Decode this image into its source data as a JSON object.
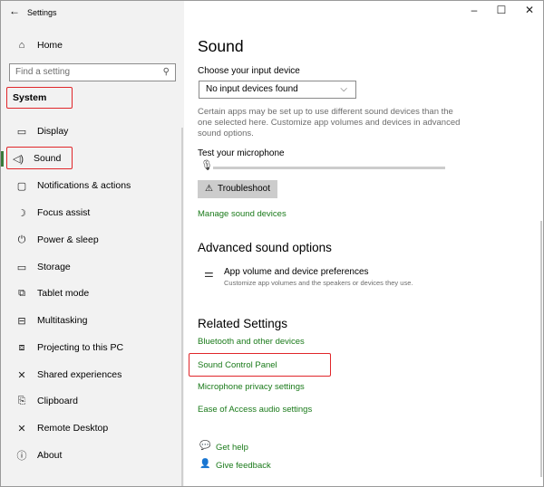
{
  "window": {
    "title": "Settings",
    "back_icon": "arrow-left-icon",
    "controls": {
      "minimize": "–",
      "maximize": "☐",
      "close": "✕"
    }
  },
  "sidebar": {
    "home_label": "Home",
    "search_placeholder": "Find a setting",
    "section_label": "System",
    "items": [
      {
        "label": "Display",
        "icon": "display-icon",
        "glyph": "▭"
      },
      {
        "label": "Sound",
        "icon": "speaker-icon",
        "glyph": "🔈"
      },
      {
        "label": "Notifications & actions",
        "icon": "notification-icon",
        "glyph": "▢"
      },
      {
        "label": "Focus assist",
        "icon": "moon-icon",
        "glyph": "☽"
      },
      {
        "label": "Power & sleep",
        "icon": "power-icon",
        "glyph": "⏻"
      },
      {
        "label": "Storage",
        "icon": "storage-icon",
        "glyph": "▭"
      },
      {
        "label": "Tablet mode",
        "icon": "tablet-icon",
        "glyph": "⧉"
      },
      {
        "label": "Multitasking",
        "icon": "multitasking-icon",
        "glyph": "⊟"
      },
      {
        "label": "Projecting to this PC",
        "icon": "projector-icon",
        "glyph": "⧈"
      },
      {
        "label": "Shared experiences",
        "icon": "shared-icon",
        "glyph": "✕"
      },
      {
        "label": "Clipboard",
        "icon": "clipboard-icon",
        "glyph": "⎘"
      },
      {
        "label": "Remote Desktop",
        "icon": "remote-icon",
        "glyph": "✕"
      },
      {
        "label": "About",
        "icon": "info-icon",
        "glyph": "ⓘ"
      }
    ]
  },
  "main": {
    "title": "Sound",
    "input_label": "Choose your input device",
    "input_value": "No input devices found",
    "info_text": "Certain apps may be set up to use different sound devices than the one selected here. Customize app volumes and devices in advanced sound options.",
    "test_label": "Test your microphone",
    "mic_level": 0,
    "troubleshoot_label": "Troubleshoot",
    "manage_link": "Manage sound devices",
    "advanced_title": "Advanced sound options",
    "app_volume_title": "App volume and device preferences",
    "app_volume_desc": "Customize app volumes and the speakers or devices they use.",
    "related_title": "Related Settings",
    "related_links": [
      "Bluetooth and other devices",
      "Sound Control Panel",
      "Microphone privacy settings",
      "Ease of Access audio settings"
    ],
    "help_label": "Get help",
    "feedback_label": "Give feedback"
  },
  "colors": {
    "accent_link": "#1a7a1a",
    "highlight": "#e0262a",
    "sidebar_bg": "#f2f2f2"
  }
}
